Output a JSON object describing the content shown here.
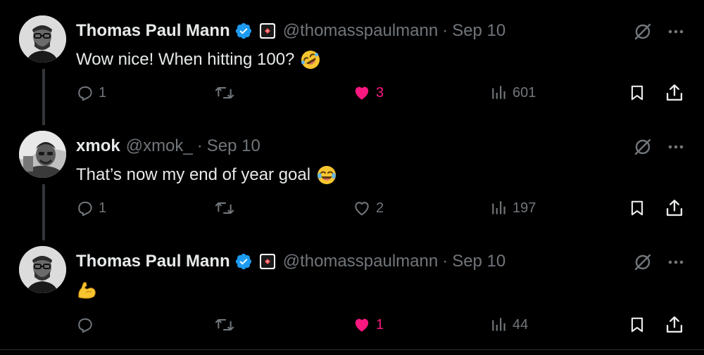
{
  "colors": {
    "background": "#000000",
    "primary_text": "#e7e9ea",
    "secondary_text": "#71767b",
    "like_pink": "#f91880",
    "verified_blue": "#1d9bf0"
  },
  "tweets": [
    {
      "name": "Thomas Paul Mann",
      "verified": true,
      "affiliate_badge": true,
      "handle": "@thomasspaulmann",
      "separator": "·",
      "time": "Sep 10",
      "text": "Wow nice! When hitting 100?",
      "emoji": "rolling-on-floor-laughing",
      "replies": "1",
      "reposts": "",
      "likes": "3",
      "liked": true,
      "views": "601"
    },
    {
      "name": "xmok",
      "verified": false,
      "affiliate_badge": false,
      "handle": "@xmok_",
      "separator": "·",
      "time": "Sep 10",
      "text": "That’s now my end of year goal",
      "emoji": "face-with-tears-of-joy",
      "replies": "1",
      "reposts": "",
      "likes": "2",
      "liked": false,
      "views": "197"
    },
    {
      "name": "Thomas Paul Mann",
      "verified": true,
      "affiliate_badge": true,
      "handle": "@thomasspaulmann",
      "separator": "·",
      "time": "Sep 10",
      "text": "",
      "emoji": "flexed-biceps",
      "replies": "",
      "reposts": "",
      "likes": "1",
      "liked": true,
      "views": "44"
    }
  ],
  "icons": {
    "reply": "reply-icon",
    "repost": "repost-icon",
    "like": "heart-icon",
    "views": "views-icon",
    "bookmark": "bookmark-icon",
    "share": "share-icon",
    "grok": "grok-icon",
    "more": "more-icon"
  }
}
